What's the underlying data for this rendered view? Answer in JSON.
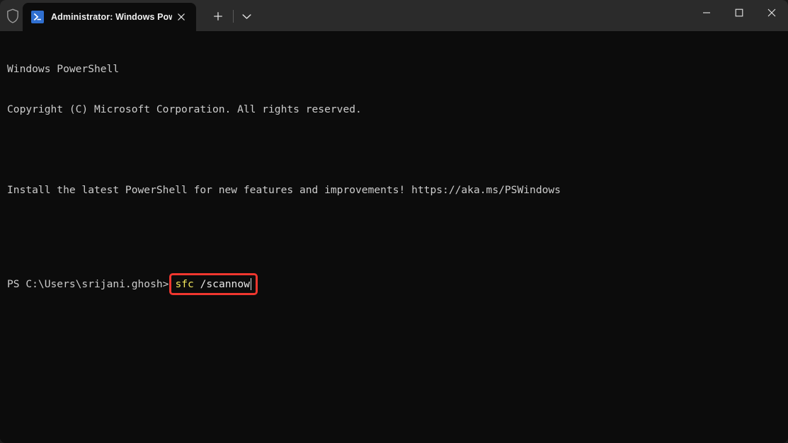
{
  "window": {
    "chrome_color": "#2b2b2b",
    "terminal_bg": "#0c0c0c",
    "accent_red": "#f0372f"
  },
  "titlebar": {
    "shield_icon": "shield-icon",
    "tab": {
      "app_icon": "powershell-icon",
      "title": "Administrator: Windows Powe",
      "close_icon": "close-icon"
    },
    "new_tab_label": "+",
    "dropdown_icon": "chevron-down-icon",
    "controls": {
      "minimize_icon": "minimize-icon",
      "maximize_icon": "maximize-icon",
      "close_icon": "close-icon"
    }
  },
  "terminal": {
    "lines": [
      "Windows PowerShell",
      "Copyright (C) Microsoft Corporation. All rights reserved.",
      "",
      "Install the latest PowerShell for new features and improvements! https://aka.ms/PSWindows",
      ""
    ],
    "prompt": "PS C:\\Users\\srijani.ghosh>",
    "command": {
      "name": "sfc",
      "args": " /scannow"
    }
  }
}
